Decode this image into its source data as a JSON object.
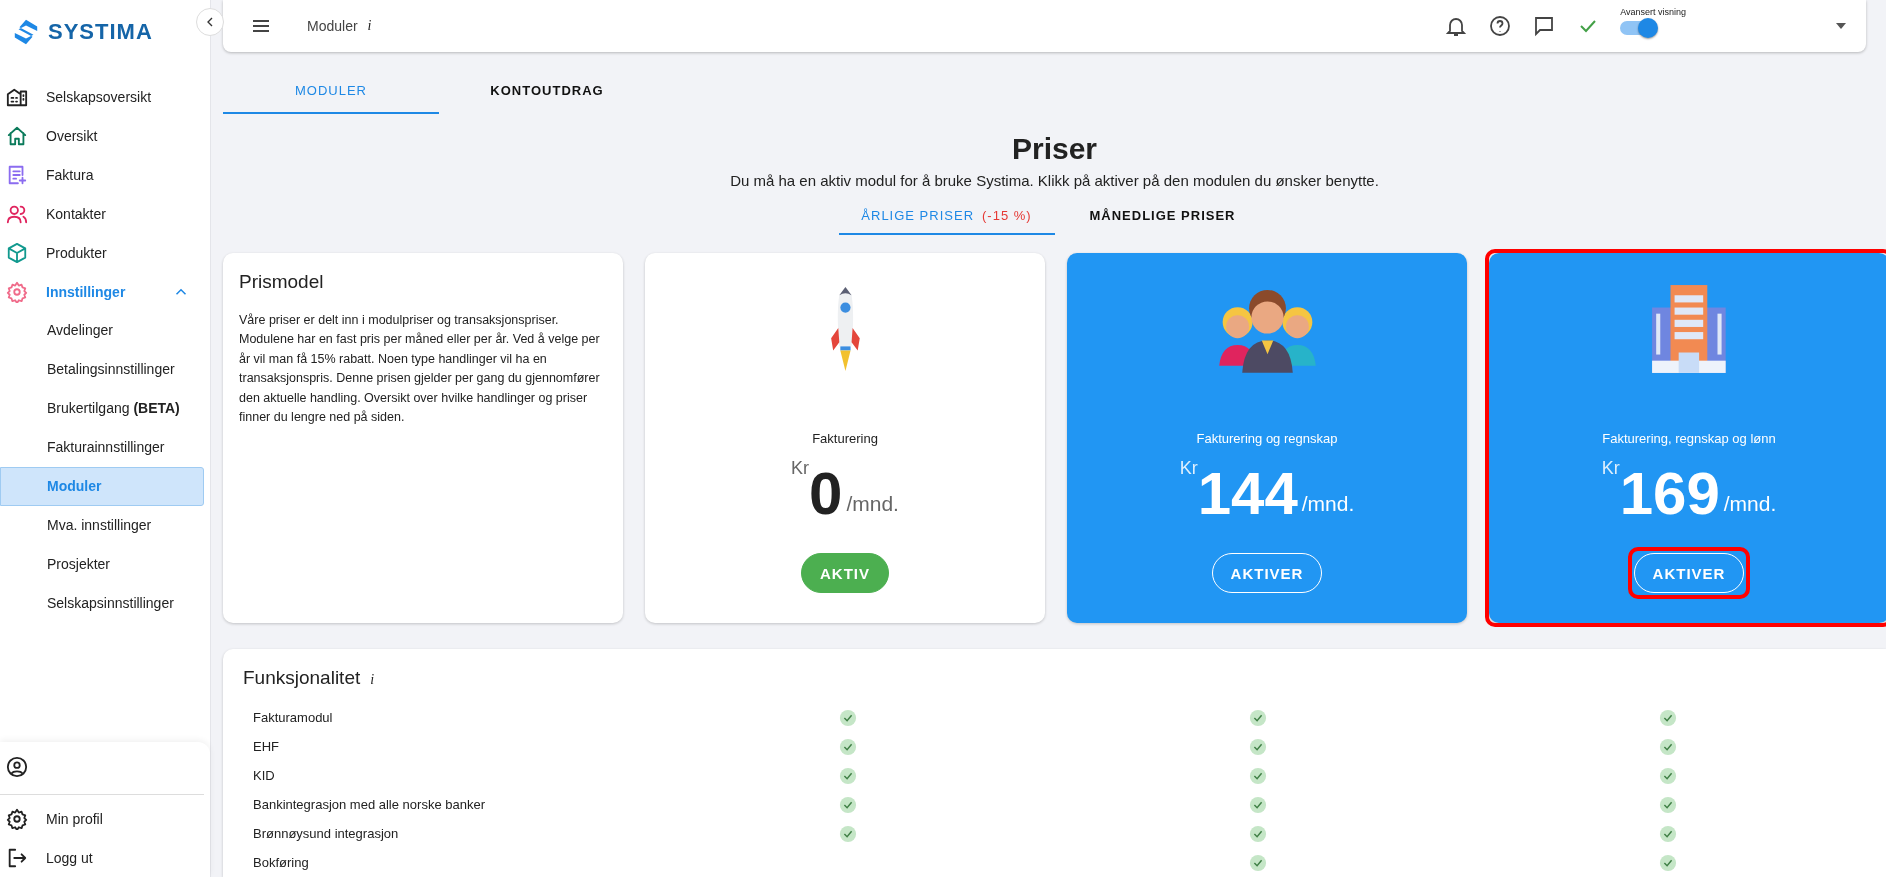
{
  "brand": "SYSTIMA",
  "nav": [
    {
      "label": "Selskapsoversikt",
      "selected": false
    },
    {
      "label": "Oversikt",
      "selected": false
    },
    {
      "label": "Faktura",
      "selected": false
    },
    {
      "label": "Kontakter",
      "selected": false
    },
    {
      "label": "Produkter",
      "selected": false
    },
    {
      "label": "Innstillinger",
      "selected": true,
      "expanded": true,
      "children": [
        {
          "label": "Avdelinger",
          "selected": false
        },
        {
          "label": "Betalingsinnstillinger",
          "selected": false
        },
        {
          "label": "Brukertilgang **(BETA)**",
          "selected": false
        },
        {
          "label": "Fakturainnstillinger",
          "selected": false
        },
        {
          "label": "Moduler",
          "selected": true
        },
        {
          "label": "Mva. innstillinger",
          "selected": false
        },
        {
          "label": "Prosjekter",
          "selected": false
        },
        {
          "label": "Selskapsinnstillinger",
          "selected": false
        }
      ]
    }
  ],
  "account_menu": [
    {
      "label": "Min profil"
    },
    {
      "label": "Logg ut"
    }
  ],
  "topbar": {
    "title": "Moduler",
    "info": "i",
    "toggle": {
      "label": "Avansert visning",
      "on": true
    }
  },
  "tabs": [
    {
      "label": "MODULER",
      "selected": true
    },
    {
      "label": "KONTOUTDRAG",
      "selected": false
    }
  ],
  "heading": "Priser",
  "subtitle": "Du må ha en aktiv modul for å bruke Systima. Klikk på aktiver på den modulen du ønsker benytte.",
  "price_tabs": [
    {
      "label": "ÅRLIGE PRISER",
      "discount": "(-15 %)",
      "selected": true
    },
    {
      "label": "MÅNEDLIGE PRISER",
      "selected": false
    }
  ],
  "price_model": {
    "title": "Prismodel",
    "text": "Våre priser er delt inn i modulpriser og transaksjonspriser. Modulene har en fast pris per måned eller per år. Ved å velge per år vil man få 15% rabatt. Noen type handlinger vil ha en transaksjonspris. Denne prisen gjelder per gang du gjennomfører den aktuelle handling. Oversikt over hvilke handlinger og priser finner du lengre ned på siden."
  },
  "modules": [
    {
      "name": "Fakturering",
      "currency": "Kr",
      "price": "0",
      "unit": "/mnd.",
      "button": "AKTIV",
      "active": true,
      "highlighted": false
    },
    {
      "name": "Fakturering og regnskap",
      "currency": "Kr",
      "price": "144",
      "unit": "/mnd.",
      "button": "AKTIVER",
      "active": false,
      "highlighted": false
    },
    {
      "name": "Fakturering, regnskap og lønn",
      "currency": "Kr",
      "price": "169",
      "unit": "/mnd.",
      "button": "AKTIVER",
      "active": false,
      "highlighted": true
    }
  ],
  "features": {
    "title": "Funksjonalitet",
    "info": "i",
    "rows": [
      {
        "name": "Fakturamodul",
        "included": [
          true,
          true,
          true
        ]
      },
      {
        "name": "EHF",
        "included": [
          true,
          true,
          true
        ]
      },
      {
        "name": "KID",
        "included": [
          true,
          true,
          true
        ]
      },
      {
        "name": "Bankintegrasjon med alle norske banker",
        "included": [
          true,
          true,
          true
        ]
      },
      {
        "name": "Brønnøysund integrasjon",
        "included": [
          true,
          true,
          true
        ]
      },
      {
        "name": "Bokføring",
        "included": [
          false,
          true,
          true
        ]
      }
    ]
  }
}
